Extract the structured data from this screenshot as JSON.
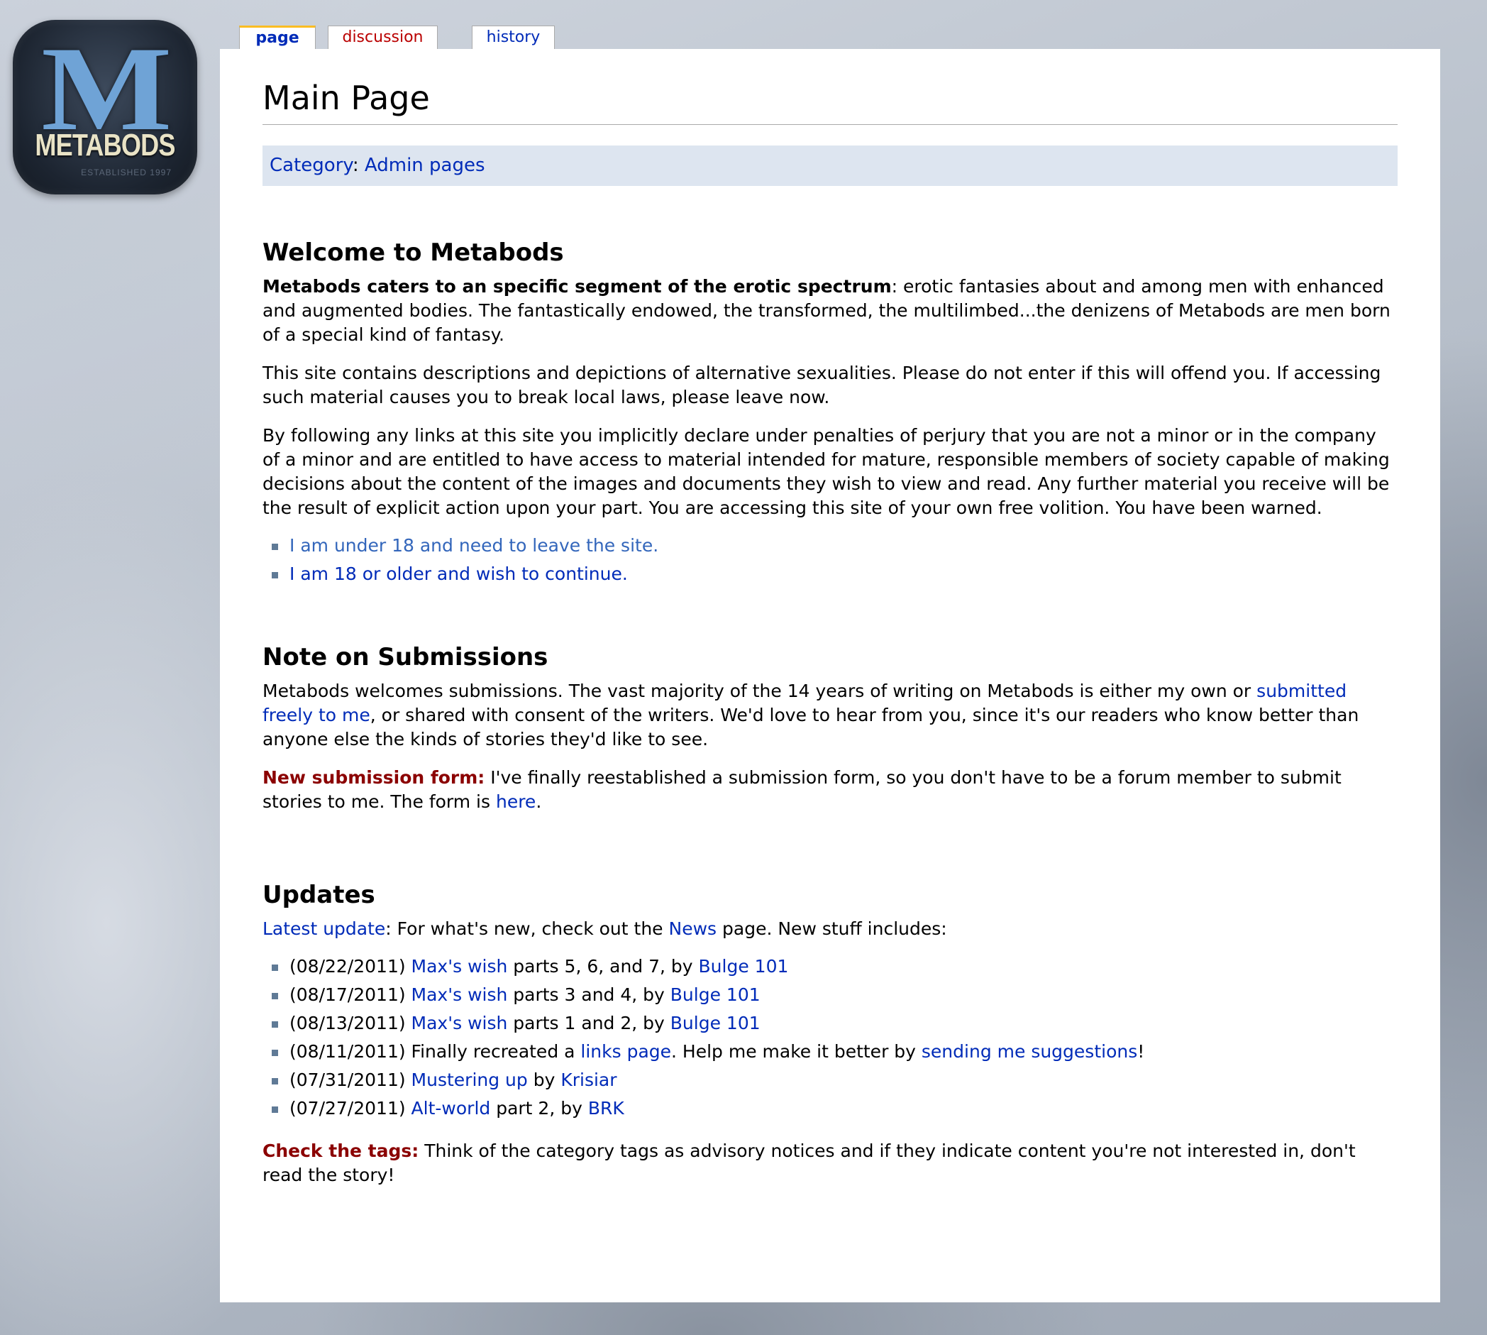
{
  "logo": {
    "initial": "M",
    "wordmark": "METABODS",
    "established": "ESTABLISHED 1997"
  },
  "tabs": {
    "page": "page",
    "discussion": "discussion",
    "history": "history"
  },
  "page": {
    "title": "Main Page"
  },
  "category": {
    "label": "Category",
    "separator": ":",
    "value": "Admin pages"
  },
  "welcome": {
    "heading": "Welcome to Metabods",
    "p1_bold": "Metabods caters to an specific segment of the erotic spectrum",
    "p1_rest": ": erotic fantasies about and among men with enhanced and augmented bodies. The fantastically endowed, the transformed, the multilimbed...the denizens of Metabods are men born of a special kind of fantasy.",
    "p2": "This site contains descriptions and depictions of alternative sexualities. Please do not enter if this will offend you. If accessing such material causes you to break local laws, please leave now.",
    "p3": "By following any links at this site you implicitly declare under penalties of perjury that you are not a minor or in the company of a minor and are entitled to have access to material intended for mature, responsible members of society capable of making decisions about the content of the images and documents they wish to view and read. Any further material you receive will be the result of explicit action upon your part. You are accessing this site of your own free volition. You have been warned.",
    "leave_link": "I am under 18 and need to leave the site.",
    "continue_link": "I am 18 or older and wish to continue."
  },
  "submissions": {
    "heading": "Note on Submissions",
    "p1_a": "Metabods welcomes submissions. The vast majority of the 14 years of writing on Metabods is either my own or ",
    "p1_link": "submitted freely to me",
    "p1_b": ", or shared with consent of the writers. We'd love to hear from you, since it's our readers who know better than anyone else the kinds of stories they'd like to see.",
    "p2_label": "New submission form:",
    "p2_a": " I've finally reestablished a submission form, so you don't have to be a forum member to submit stories to me. The form is ",
    "p2_link": "here",
    "p2_b": "."
  },
  "updates": {
    "heading": "Updates",
    "intro_link": "Latest update",
    "intro_a": ": For what's new, check out the ",
    "intro_news": "News",
    "intro_b": " page. New stuff includes:",
    "items": [
      {
        "date": "(08/22/2011) ",
        "link1": "Max's wish",
        "mid": " parts 5, 6, and 7, by ",
        "link2": "Bulge 101",
        "end": ""
      },
      {
        "date": "(08/17/2011) ",
        "link1": "Max's wish",
        "mid": " parts 3 and 4, by ",
        "link2": "Bulge 101",
        "end": ""
      },
      {
        "date": "(08/13/2011) ",
        "link1": "Max's wish",
        "mid": " parts 1 and 2, by ",
        "link2": "Bulge 101",
        "end": ""
      },
      {
        "date": "(08/11/2011) Finally recreated a ",
        "link1": "links page",
        "mid": ". Help me make it better by ",
        "link2": "sending me suggestions",
        "end": "!"
      },
      {
        "date": "(07/31/2011) ",
        "link1": "Mustering up",
        "mid": " by ",
        "link2": "Krisiar",
        "end": ""
      },
      {
        "date": "(07/27/2011) ",
        "link1": "Alt-world",
        "mid": " part 2, by ",
        "link2": "BRK",
        "end": ""
      }
    ],
    "tags_label": "Check the tags:",
    "tags_text": " Think of the category tags as advisory notices and if they indicate content you're not interested in, don't read the story!"
  },
  "colors": {
    "link": "#002bb8",
    "visited_link": "#3366bb",
    "alert": "#8b0000",
    "tab_highlight": "#fabd23",
    "category_bg": "#dde5f0"
  }
}
